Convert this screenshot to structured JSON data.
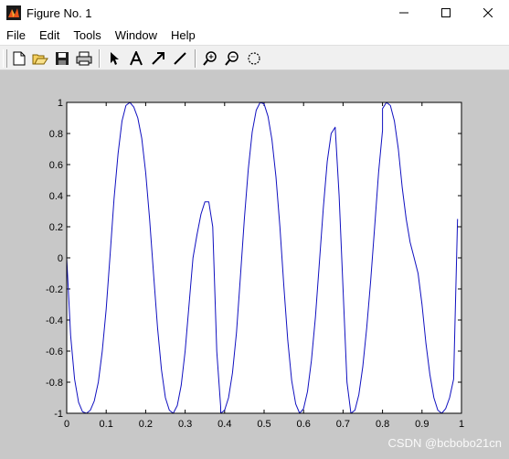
{
  "window": {
    "title": "Figure No. 1",
    "icons": [
      "app-icon",
      "minimize-icon",
      "maximize-icon",
      "close-icon"
    ]
  },
  "menu": [
    "File",
    "Edit",
    "Tools",
    "Window",
    "Help"
  ],
  "toolbar": {
    "buttons": [
      "new-figure-icon",
      "open-icon",
      "save-icon",
      "print-icon",
      "arrow-select-icon",
      "insert-text-icon",
      "insert-arrow-icon",
      "insert-line-icon",
      "zoom-in-icon",
      "zoom-out-icon",
      "rotate-3d-icon"
    ]
  },
  "watermark": "CSDN @bcbobo21cn",
  "colors": {
    "line": "#1010c0",
    "figure_bg": "#c8c8c8",
    "axes_bg": "#ffffff"
  },
  "chart_data": {
    "type": "line",
    "title": "",
    "xlabel": "",
    "ylabel": "",
    "xlim": [
      0,
      1
    ],
    "ylim": [
      -1,
      1
    ],
    "xticks": [
      "0",
      "0.1",
      "0.2",
      "0.3",
      "0.4",
      "0.5",
      "0.6",
      "0.7",
      "0.8",
      "0.9",
      "1"
    ],
    "yticks": [
      "1",
      "0.8",
      "0.6",
      "0.4",
      "0.2",
      "0",
      "-0.2",
      "-0.4",
      "-0.6",
      "-0.8",
      "-1"
    ],
    "grid": false,
    "series": [
      {
        "x": [
          0,
          0.01,
          0.02,
          0.03,
          0.04,
          0.05,
          0.06,
          0.07,
          0.08,
          0.09,
          0.1,
          0.11,
          0.12,
          0.13,
          0.14,
          0.15,
          0.16,
          0.17,
          0.18,
          0.19,
          0.2,
          0.21,
          0.22,
          0.23,
          0.24,
          0.25,
          0.26,
          0.27,
          0.28,
          0.29,
          0.3,
          0.31,
          0.32,
          0.33,
          0.34,
          0.35,
          0.36,
          0.37,
          0.38,
          0.39,
          0.39,
          0.4,
          0.41,
          0.42,
          0.43,
          0.44,
          0.45,
          0.46,
          0.47,
          0.48,
          0.49,
          0.5,
          0.51,
          0.52,
          0.53,
          0.54,
          0.55,
          0.56,
          0.57,
          0.58,
          0.59,
          0.6,
          0.61,
          0.62,
          0.63,
          0.64,
          0.65,
          0.66,
          0.67,
          0.68,
          0.69,
          0.7,
          0.71,
          0.72,
          0.73,
          0.74,
          0.75,
          0.76,
          0.77,
          0.78,
          0.79,
          0.8,
          0.8,
          0.81,
          0.82,
          0.83,
          0.84,
          0.85,
          0.86,
          0.87,
          0.88,
          0.89,
          0.9,
          0.91,
          0.92,
          0.93,
          0.94,
          0.95,
          0.96,
          0.97,
          0.98,
          0.99
        ],
        "y": [
          0.0,
          -0.5,
          -0.78,
          -0.93,
          -0.99,
          -1.0,
          -0.98,
          -0.92,
          -0.8,
          -0.6,
          -0.33,
          0.02,
          0.38,
          0.67,
          0.88,
          0.98,
          1.0,
          0.97,
          0.9,
          0.77,
          0.55,
          0.25,
          -0.1,
          -0.45,
          -0.72,
          -0.9,
          -0.98,
          -1.0,
          -0.95,
          -0.82,
          -0.6,
          -0.3,
          0.0,
          0.15,
          0.28,
          0.36,
          0.36,
          0.2,
          -0.6,
          -0.96,
          -1.0,
          -0.98,
          -0.9,
          -0.74,
          -0.48,
          -0.12,
          0.25,
          0.57,
          0.81,
          0.95,
          1.0,
          0.99,
          0.91,
          0.76,
          0.52,
          0.2,
          -0.18,
          -0.53,
          -0.79,
          -0.94,
          -1.0,
          -0.97,
          -0.86,
          -0.66,
          -0.38,
          -0.03,
          0.32,
          0.62,
          0.8,
          0.84,
          0.4,
          -0.2,
          -0.8,
          -1.0,
          -0.98,
          -0.88,
          -0.7,
          -0.45,
          -0.15,
          0.2,
          0.55,
          0.82,
          0.96,
          1.0,
          0.98,
          0.88,
          0.7,
          0.45,
          0.25,
          0.1,
          0.0,
          -0.1,
          -0.3,
          -0.55,
          -0.75,
          -0.9,
          -0.98,
          -1.0,
          -0.97,
          -0.9,
          -0.78,
          0.25
        ]
      }
    ]
  }
}
